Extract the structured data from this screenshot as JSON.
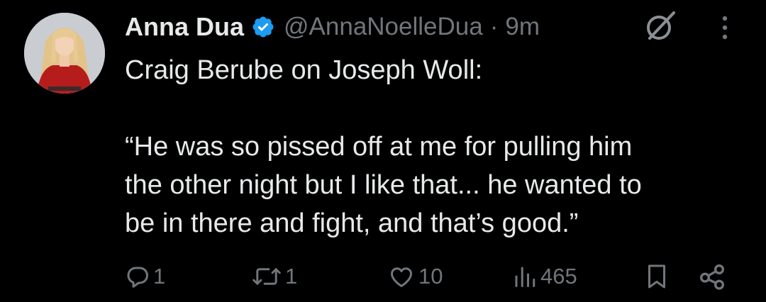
{
  "author": {
    "name": "Anna Dua",
    "handle": "@AnnaNoelleDua",
    "separator": "·",
    "time": "9m",
    "verified": true
  },
  "tweet": {
    "line1": "Craig Berube on Joseph Woll:",
    "quote_line1": "“He was so pissed off at me for pulling him",
    "quote_line2": "the other night but I like that... he wanted to",
    "quote_line3": "be in there and fight, and that’s good.”"
  },
  "actions": {
    "replies": "1",
    "reposts": "1",
    "likes": "10",
    "views": "465"
  },
  "colors": {
    "background": "#000000",
    "text": "#e7e9ea",
    "muted": "#71767b",
    "verified": "#1d9bf0"
  },
  "icons": [
    "verified-badge-icon",
    "grok-icon",
    "more-options-icon",
    "reply-icon",
    "repost-icon",
    "like-icon",
    "views-icon",
    "bookmark-icon",
    "share-icon"
  ]
}
